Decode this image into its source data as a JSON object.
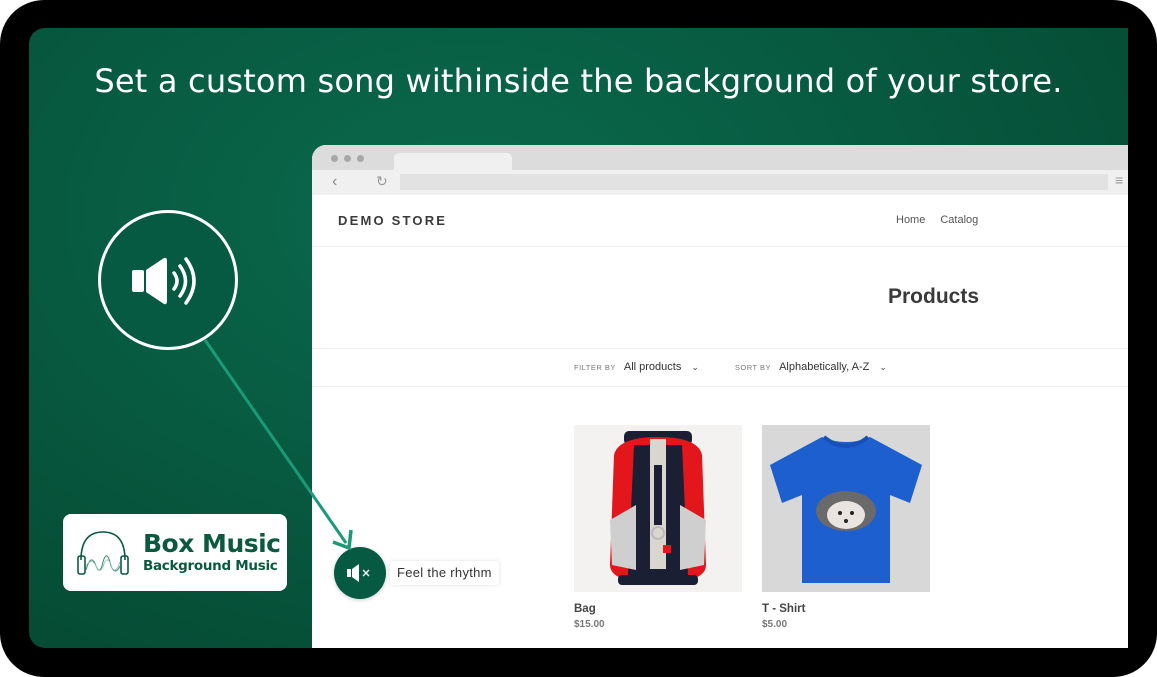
{
  "banner": {
    "headline": "Set a custom song withinside the background of your store.",
    "accent_color": "#1a9a78",
    "background_color": "#075a40"
  },
  "logo": {
    "title": "Box Music",
    "subtitle": "Background Music",
    "icon": "headphones-icon"
  },
  "speaker_badge": {
    "icon": "speaker-volume-icon"
  },
  "browser": {
    "back_icon": "chevron-left-icon",
    "reload_icon": "reload-icon",
    "menu_icon": "hamburger-menu-icon",
    "url": ""
  },
  "store": {
    "brand": "DEMO STORE",
    "nav": [
      "Home",
      "Catalog"
    ],
    "page_title": "Products",
    "filter": {
      "label": "FILTER BY",
      "value": "All products"
    },
    "sort": {
      "label": "SORT BY",
      "value": "Alphabetically, A-Z"
    },
    "products": [
      {
        "name": "Bag",
        "price": "$15.00",
        "image": "red-black-backpack"
      },
      {
        "name": "T - Shirt",
        "price": "$5.00",
        "image": "blue-hedgehog-tshirt"
      }
    ]
  },
  "player": {
    "icon": "speaker-muted-icon",
    "tooltip": "Feel the rhythm"
  }
}
